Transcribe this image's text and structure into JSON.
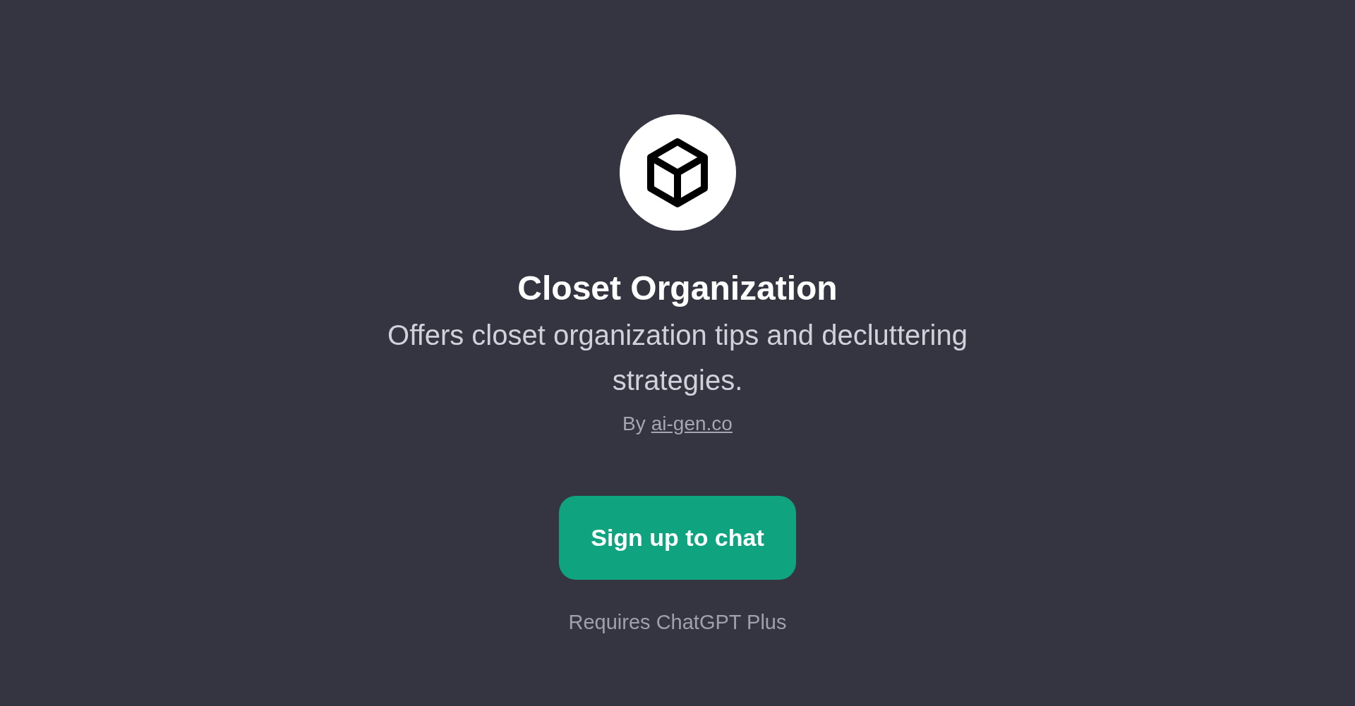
{
  "title": "Closet Organization",
  "description": "Offers closet organization tips and decluttering strategies.",
  "author": {
    "prefix": "By",
    "link": "ai-gen.co"
  },
  "button": "Sign up to chat",
  "note": "Requires ChatGPT Plus"
}
